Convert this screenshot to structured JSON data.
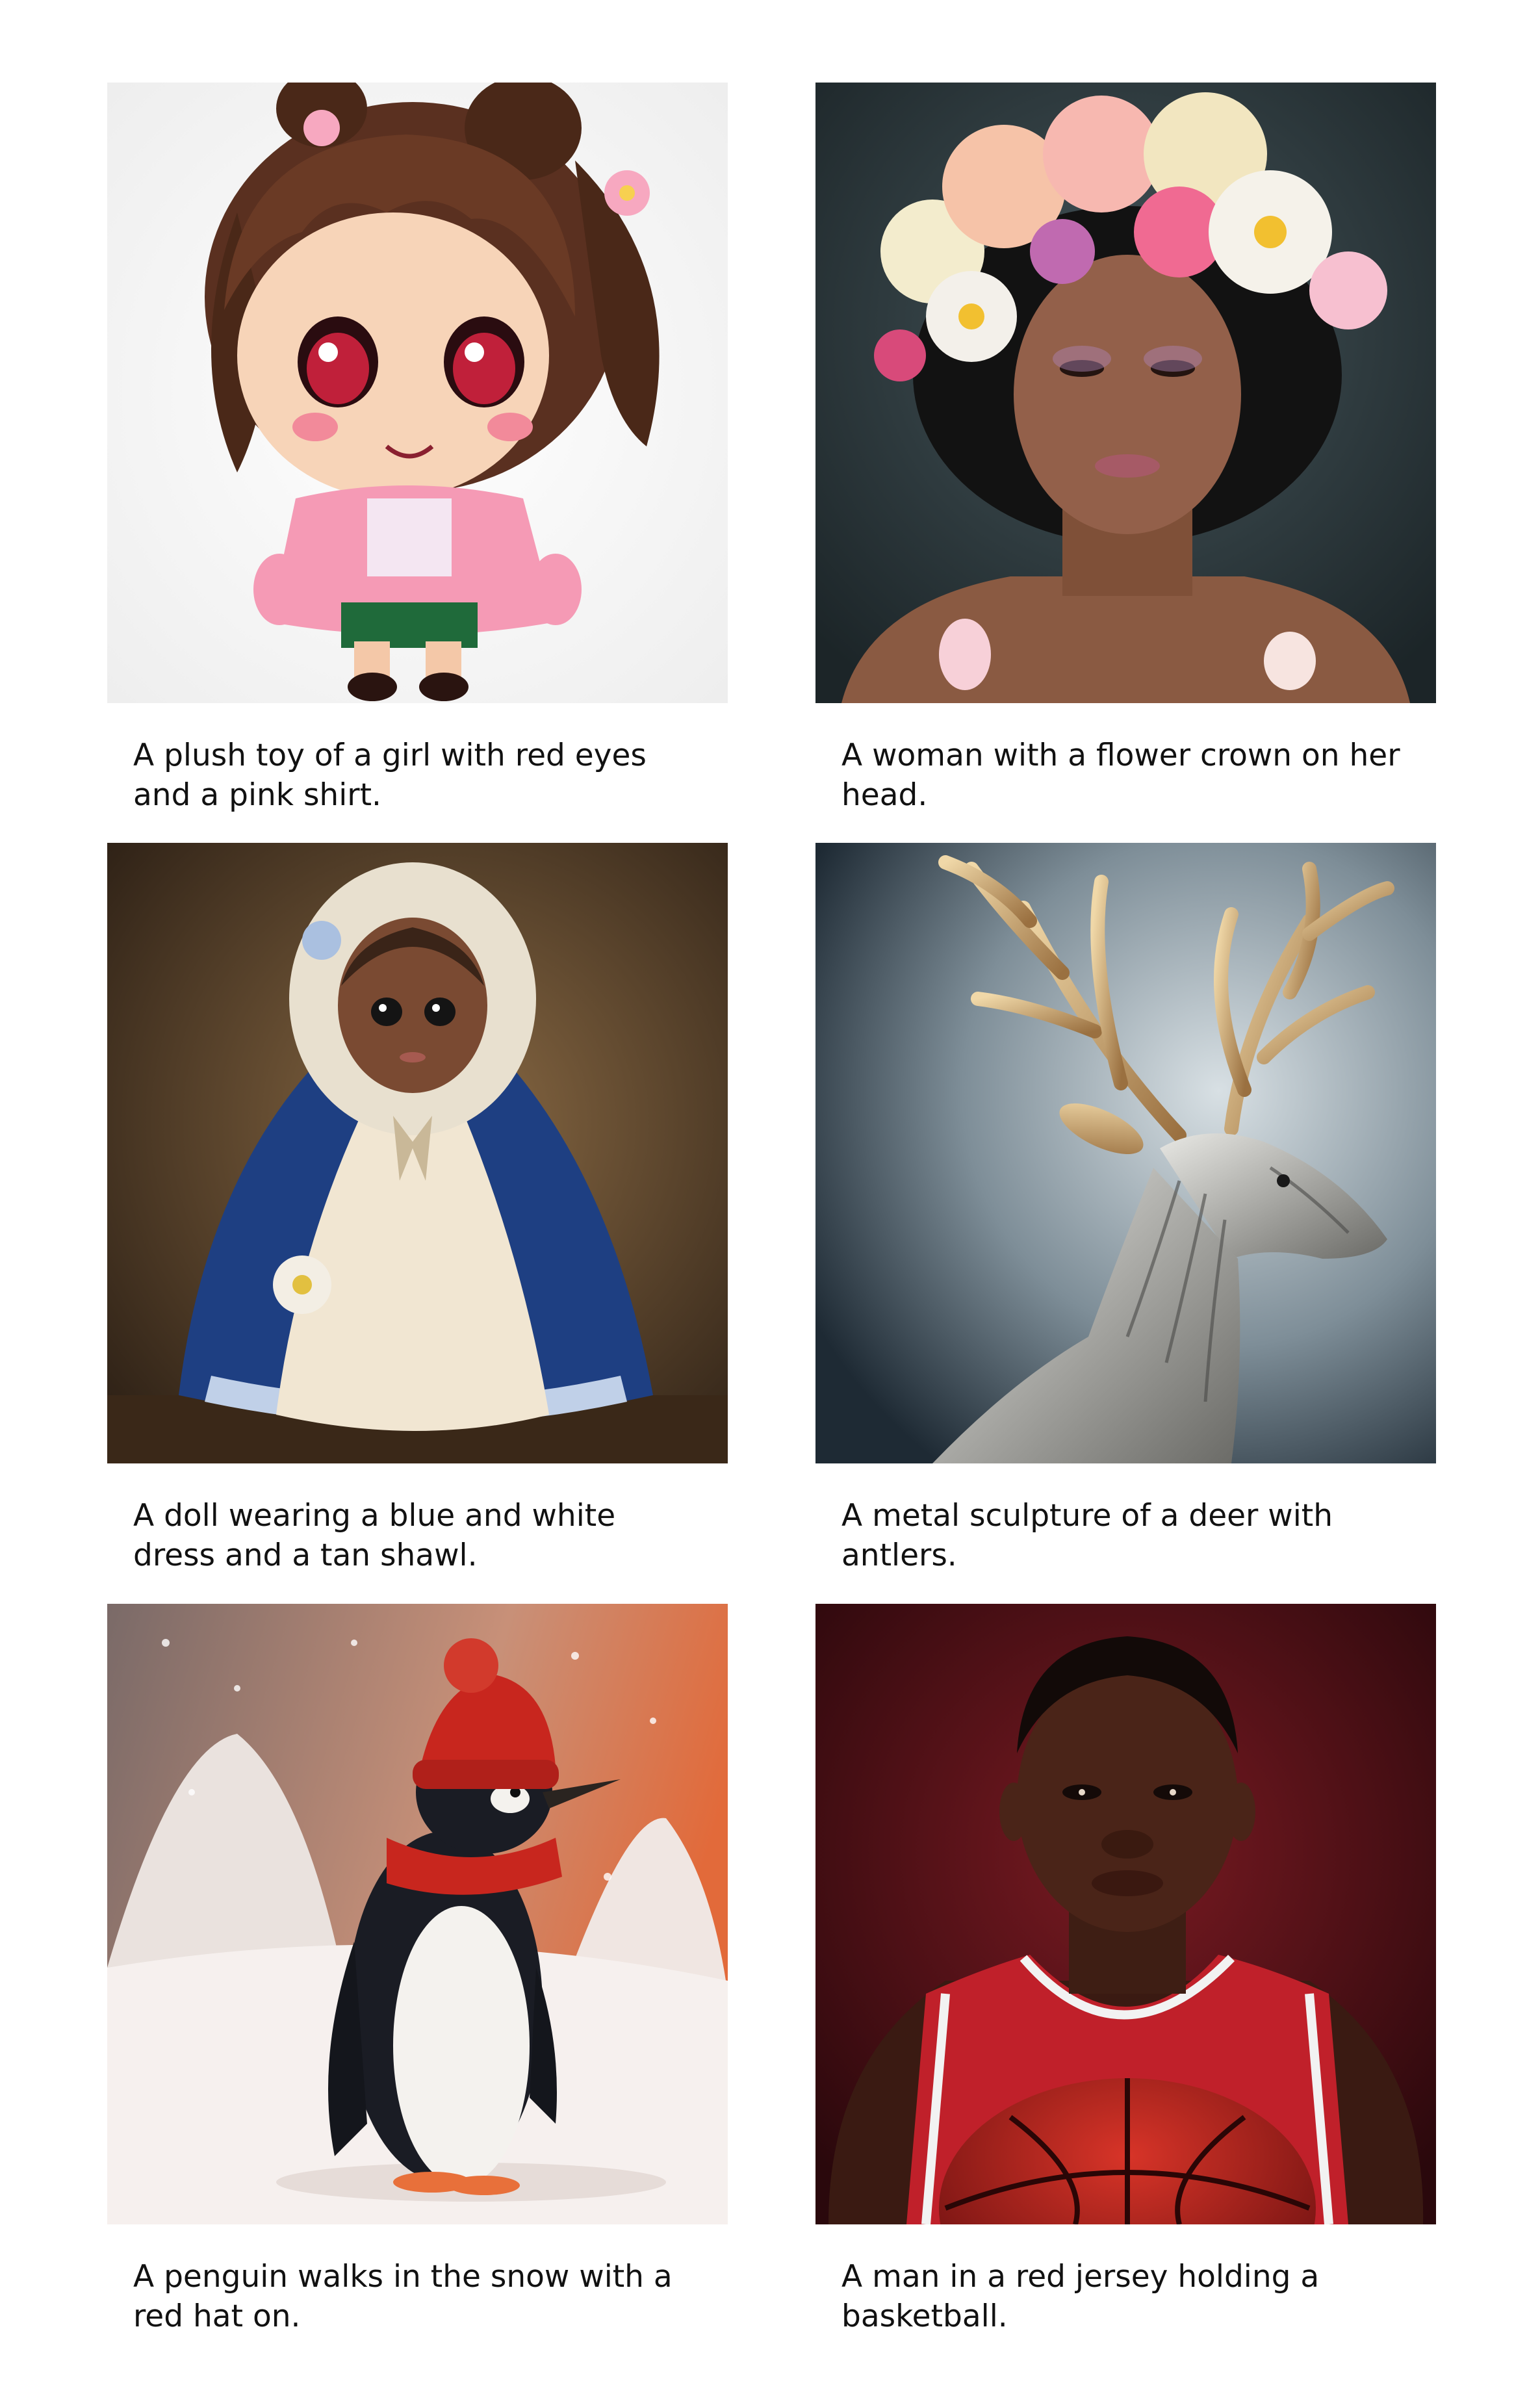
{
  "cards": [
    {
      "image": "plush-toy-girl-image",
      "caption": "A plush toy of a girl with red eyes and a pink shirt."
    },
    {
      "image": "woman-flower-crown-image",
      "caption": "A woman with a flower crown on her head."
    },
    {
      "image": "doll-blue-white-dress-image",
      "caption": "A doll wearing a blue and white dress and a tan shawl."
    },
    {
      "image": "metal-deer-sculpture-image",
      "caption": "A metal sculpture of a deer with antlers."
    },
    {
      "image": "penguin-red-hat-snow-image",
      "caption": "A penguin walks in the snow with a red hat on."
    },
    {
      "image": "basketball-player-red-jersey-image",
      "caption": "A man in a red jersey holding a basketball."
    }
  ]
}
